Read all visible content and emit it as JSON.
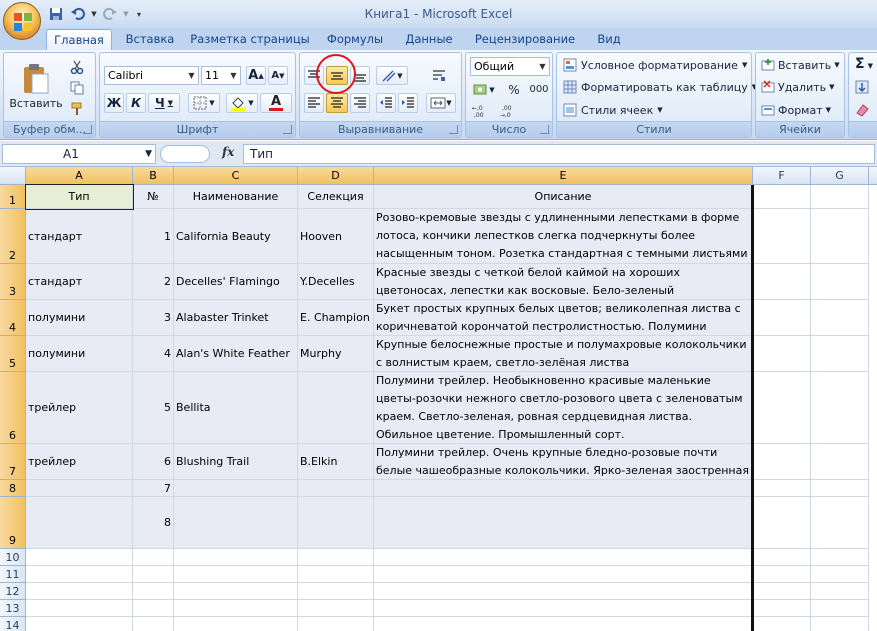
{
  "window": {
    "title": "Книга1 - Microsoft Excel"
  },
  "tabs": [
    {
      "label": "Главная",
      "active": true
    },
    {
      "label": "Вставка"
    },
    {
      "label": "Разметка страницы"
    },
    {
      "label": "Формулы"
    },
    {
      "label": "Данные"
    },
    {
      "label": "Рецензирование"
    },
    {
      "label": "Вид"
    }
  ],
  "ribbon": {
    "clipboard": {
      "caption": "Буфер обм...",
      "paste_label": "Вставить"
    },
    "font": {
      "caption": "Шрифт",
      "font_name": "Calibri",
      "font_size": "11",
      "bold": "Ж",
      "italic": "К",
      "underline": "Ч",
      "grow": "A",
      "shrink": "A",
      "color_letter": "A"
    },
    "alignment": {
      "caption": "Выравнивание"
    },
    "number": {
      "caption": "Число",
      "format": "Общий",
      "percent": "%",
      "thousands": "000"
    },
    "styles": {
      "caption": "Стили",
      "conditional": "Условное форматирование",
      "as_table": "Форматировать как таблицу",
      "cell_styles": "Стили ячеек"
    },
    "cells": {
      "caption": "Ячейки",
      "insert": "Вставить",
      "delete": "Удалить",
      "format": "Формат"
    },
    "editing": {
      "sum_symbol": "Σ"
    },
    "highlight_color": "#e0151c"
  },
  "formula_bar": {
    "name_box": "A1",
    "fx": "fx",
    "content": "Тип"
  },
  "columns": [
    "A",
    "B",
    "C",
    "D",
    "E",
    "F",
    "G"
  ],
  "rows": [
    {
      "num": "1",
      "cells": [
        "Тип",
        "№",
        "Наименование",
        "Селекция",
        "Описание"
      ]
    },
    {
      "num": "2",
      "cells": [
        "стандарт",
        "1",
        "California Beauty",
        "Hooven",
        "Розово-кремовые звезды с удлиненными лепестками в форме лотоса, кончики лепестков слегка подчеркнуты более насыщенным тоном. Розетка стандартная с темными листьями"
      ]
    },
    {
      "num": "3",
      "cells": [
        "стандарт",
        "2",
        "Decelles' Flamingo",
        "Y.Decelles",
        "Красные звезды с четкой белой каймой на хороших цветоносах, лепестки как восковые. Бело-зеленый пестролистник."
      ]
    },
    {
      "num": "4",
      "cells": [
        "полумини",
        "3",
        "Alabaster Trinket",
        "E. Champion",
        "Букет простых крупных белых цветов; великолепная листва с коричневатой кoрoнчатой пестролистностью. Полумини"
      ]
    },
    {
      "num": "5",
      "cells": [
        "полумини",
        "4",
        "Alan's White Feather",
        " Murphy",
        "Крупные белоснежные простые и полумахровые колокольчики с волнистым краем, светло-зелёная листва"
      ]
    },
    {
      "num": "6",
      "cells": [
        "трейлер",
        "5",
        "Bellita",
        "",
        "Полумини трейлер. Необыкновенно красивые маленькие цветы-розочки нежного светло-розового цвета с зеленоватым краем. Светло-зеленая, ровная сердцевидная листва. Обильное цветение. Промышленный сорт."
      ]
    },
    {
      "num": "7",
      "cells": [
        "трейлер",
        "6",
        "Blushing Trail",
        "B.Elkin",
        "Полумини трейлер. Очень крупные бледно-розовые почти белые чашеобразные колокольчики. Ярко-зеленая заостренная листва."
      ]
    },
    {
      "num": "8",
      "cells": [
        "",
        "7",
        "",
        "",
        ""
      ]
    },
    {
      "num": "9",
      "cells": [
        "",
        "8",
        "",
        "",
        ""
      ]
    },
    {
      "num": "10",
      "cells": [
        "",
        "",
        "",
        "",
        ""
      ]
    },
    {
      "num": "11",
      "cells": [
        "",
        "",
        "",
        "",
        ""
      ]
    },
    {
      "num": "12",
      "cells": [
        "",
        "",
        "",
        "",
        ""
      ]
    },
    {
      "num": "13",
      "cells": [
        "",
        "",
        "",
        "",
        ""
      ]
    },
    {
      "num": "14",
      "cells": [
        "",
        "",
        "",
        "",
        ""
      ]
    }
  ]
}
